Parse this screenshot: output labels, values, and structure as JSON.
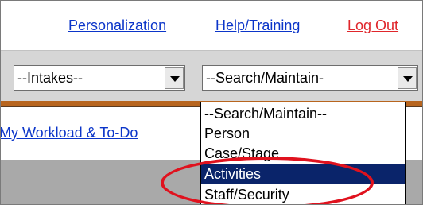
{
  "header": {
    "links": [
      {
        "label": "Personalization",
        "color": "#0b35c9"
      },
      {
        "label": "Help/Training",
        "color": "#0b35c9"
      },
      {
        "label": "Log Out",
        "color": "#e0262b"
      }
    ]
  },
  "selects": {
    "intakes": {
      "value": "--Intakes--",
      "icon": "chevron-down-icon"
    },
    "search": {
      "value": "--Search/Maintain-",
      "icon": "chevron-down-icon"
    }
  },
  "nav": {
    "workload_label": "My Workload & To-Do"
  },
  "dropdown": {
    "options": [
      {
        "label": "--Search/Maintain--",
        "selected": false
      },
      {
        "label": "Person",
        "selected": false
      },
      {
        "label": "Case/Stage",
        "selected": false
      },
      {
        "label": "Activities",
        "selected": true
      },
      {
        "label": "Staff/Security",
        "selected": false
      }
    ]
  },
  "annotation": {
    "shape": "ellipse",
    "color": "#e0121e",
    "target": "Activities"
  }
}
